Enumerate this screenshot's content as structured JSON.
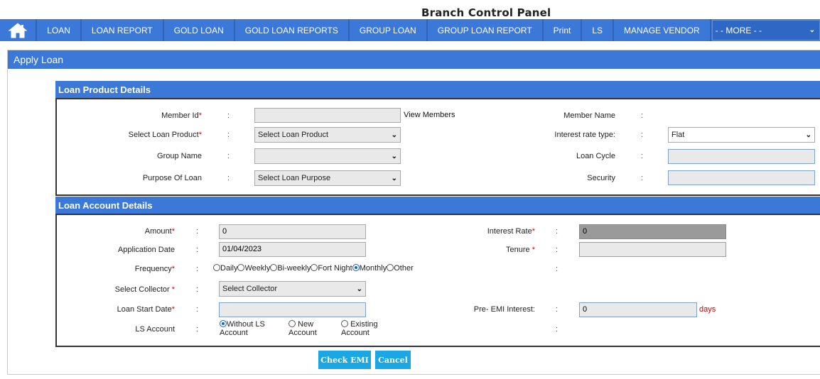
{
  "header": {
    "title": "Branch Control Panel"
  },
  "nav": {
    "items": [
      "LOAN",
      "LOAN REPORT",
      "GOLD LOAN",
      "GOLD LOAN REPORTS",
      "GROUP LOAN",
      "GROUP LOAN REPORT",
      "Print",
      "LS",
      "MANAGE VENDOR"
    ],
    "more": "- - MORE - -"
  },
  "panel": {
    "title": "Apply Loan"
  },
  "product": {
    "heading": "Loan Product Details",
    "member_id_label": "Member Id",
    "member_id_value": "",
    "view_members": "View Members",
    "member_name_label": "Member Name",
    "loan_product_label": "Select Loan Product",
    "loan_product_value": "Select Loan Product",
    "interest_type_label": "Interest rate type:",
    "interest_type_value": "Flat",
    "group_name_label": "Group Name",
    "group_name_value": "",
    "loan_cycle_label": "Loan Cycle",
    "loan_cycle_value": "",
    "purpose_label": "Purpose Of Loan",
    "purpose_value": "Select Loan Purpose",
    "security_label": "Security",
    "security_value": ""
  },
  "account": {
    "heading": "Loan Account Details",
    "amount_label": "Amount",
    "amount_value": "0",
    "interest_rate_label": "Interest Rate",
    "interest_rate_value": "0",
    "app_date_label": "Application Date",
    "app_date_value": "01/04/2023",
    "tenure_label": "Tenure ",
    "tenure_value": "",
    "frequency_label": "Frequency",
    "frequency_options": [
      "Daily",
      "Weekly",
      "Bi-weekly",
      "Fort Night",
      "Monthly",
      "Other"
    ],
    "frequency_selected": "Monthly",
    "collector_label": "Select Collector ",
    "collector_value": "Select Collector",
    "start_date_label": "Loan Start Date",
    "start_date_value": "",
    "pre_emi_label": "Pre- EMI Interest:",
    "pre_emi_value": "0",
    "pre_emi_unit": "days",
    "ls_label": "LS Account",
    "ls_options": [
      {
        "line1": "Without LS",
        "line2": "Account"
      },
      {
        "line1": "New",
        "line2": "Account"
      },
      {
        "line1": "Existing",
        "line2": "Account"
      }
    ],
    "ls_selected": "Without LS Account"
  },
  "buttons": {
    "check_emi": "Check EMI",
    "cancel": "Cancel"
  },
  "colors": {
    "accent": "#3c78d8",
    "button": "#1aa7e4",
    "required": "#dd0000"
  },
  "icons": {
    "home": "home-icon",
    "dropdown": "chevron-down-icon"
  }
}
